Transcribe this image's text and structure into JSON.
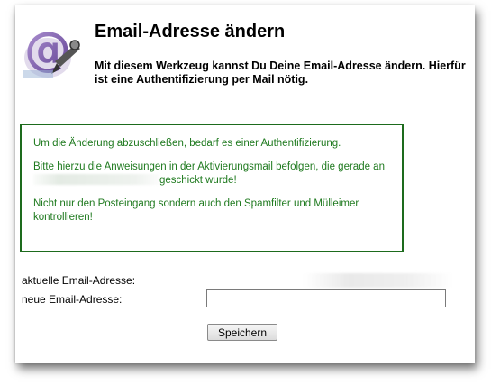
{
  "header": {
    "title": "Email-Adresse ändern",
    "subtitle": "Mit diesem Werkzeug kannst Du Deine Email-Adresse ändern. Hierfür ist eine Authentifizierung per Mail nötig.",
    "logo_icon": "email-at-sign-icon"
  },
  "notice": {
    "line1": "Um die Änderung abzuschließen, bedarf es einer Authentifizierung.",
    "line2_before": "Bitte hierzu die Anweisungen in der Aktivierungsmail befolgen, die gerade an",
    "line2_after": "geschickt wurde!",
    "line3": "Nicht nur den Posteingang sondern auch den Spamfilter und Mülleimer kontrollieren!",
    "color": "#1f7a1f",
    "border_color": "#1d6b1d"
  },
  "form": {
    "current_label": "aktuelle Email-Adresse:",
    "new_label": "neue Email-Adresse:",
    "new_value": "",
    "save_label": "Speichern"
  }
}
